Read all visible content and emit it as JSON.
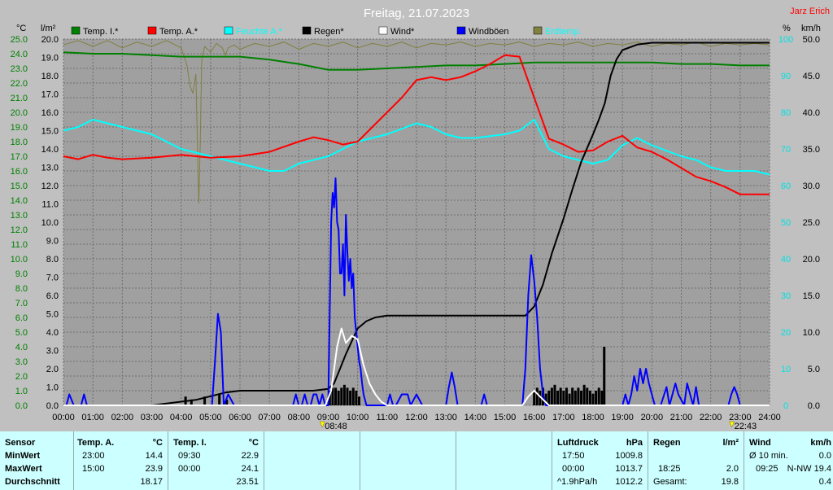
{
  "chart_data": {
    "type": "line",
    "title": "Freitag, 21.07.2023",
    "author": "Jarz Erich",
    "x_ticks": [
      "00:00",
      "01:00",
      "02:00",
      "03:00",
      "04:00",
      "05:00",
      "06:00",
      "07:00",
      "08:00",
      "09:00",
      "10:00",
      "11:00",
      "12:00",
      "13:00",
      "14:00",
      "15:00",
      "16:00",
      "17:00",
      "18:00",
      "19:00",
      "20:00",
      "21:00",
      "22:00",
      "23:00",
      "24:00"
    ],
    "y_temp": {
      "unit": "°C",
      "min": 0,
      "max": 25,
      "ticks": [
        "0.0",
        "1.0",
        "2.0",
        "3.0",
        "4.0",
        "5.0",
        "6.0",
        "7.0",
        "8.0",
        "9.0",
        "10.0",
        "11.0",
        "12.0",
        "13.0",
        "14.0",
        "15.0",
        "16.0",
        "17.0",
        "18.0",
        "19.0",
        "20.0",
        "21.0",
        "22.0",
        "23.0",
        "24.0",
        "25.0"
      ]
    },
    "y_rain": {
      "unit": "l/m²",
      "min": 0,
      "max": 20,
      "ticks": [
        "0.0",
        "1.0",
        "2.0",
        "3.0",
        "4.0",
        "5.0",
        "6.0",
        "7.0",
        "8.0",
        "9.0",
        "10.0",
        "11.0",
        "12.0",
        "13.0",
        "14.0",
        "15.0",
        "16.0",
        "17.0",
        "18.0",
        "19.0",
        "20.0"
      ]
    },
    "y_hum": {
      "unit": "%",
      "min": 0,
      "max": 100,
      "ticks": [
        "0",
        "10",
        "20",
        "30",
        "40",
        "50",
        "60",
        "70",
        "80",
        "90",
        "100"
      ]
    },
    "y_wind": {
      "unit": "km/h",
      "min": 0,
      "max": 50,
      "ticks": [
        "0.0",
        "5.0",
        "10.0",
        "15.0",
        "20.0",
        "25.0",
        "30.0",
        "35.0",
        "40.0",
        "45.0",
        "50.0"
      ]
    },
    "sun_markers": [
      {
        "hour": 8.8,
        "label": "08:48"
      },
      {
        "hour": 22.717,
        "label": "22:43"
      }
    ],
    "legend": [
      {
        "name": "Temp. I.*",
        "color": "#008000"
      },
      {
        "name": "Temp. A.*",
        "color": "#ff0000"
      },
      {
        "name": "Feuchte A.*",
        "color": "#00ffff"
      },
      {
        "name": "Regen*",
        "color": "#000000"
      },
      {
        "name": "Wind*",
        "color": "#ffffff"
      },
      {
        "name": "Windböen",
        "color": "#0000ff"
      },
      {
        "name": "Erdtemp.",
        "color": "#808040"
      }
    ],
    "series": [
      {
        "name": "Temp. I.*",
        "axis": "temp",
        "color": "#008000",
        "x": [
          0,
          1,
          2,
          3,
          4,
          5,
          6,
          7,
          8,
          9,
          10,
          11,
          12,
          13,
          14,
          15,
          16,
          17,
          18,
          19,
          20,
          21,
          22,
          23,
          24
        ],
        "y": [
          24.1,
          24.0,
          24.0,
          23.9,
          23.8,
          23.8,
          23.8,
          23.6,
          23.3,
          22.9,
          22.9,
          23.0,
          23.1,
          23.2,
          23.2,
          23.3,
          23.4,
          23.4,
          23.4,
          23.4,
          23.4,
          23.3,
          23.3,
          23.2,
          23.2
        ]
      },
      {
        "name": "Temp. A.*",
        "axis": "temp",
        "color": "#ff0000",
        "x": [
          0,
          0.5,
          1,
          1.5,
          2,
          3,
          4,
          5,
          6,
          7,
          8,
          8.5,
          9,
          9.5,
          10,
          10.5,
          11,
          11.5,
          12,
          12.5,
          13,
          13.5,
          14,
          14.5,
          15,
          15.5,
          16,
          16.5,
          17,
          17.5,
          18,
          18.5,
          19,
          19.5,
          20,
          20.5,
          21,
          21.5,
          22,
          22.5,
          23,
          23.5,
          24
        ],
        "y": [
          17.0,
          16.8,
          17.1,
          16.9,
          16.8,
          16.9,
          17.1,
          16.9,
          17.0,
          17.3,
          18.0,
          18.3,
          18.1,
          17.8,
          18.0,
          19.0,
          20.0,
          21.0,
          22.2,
          22.4,
          22.2,
          22.4,
          22.8,
          23.3,
          23.9,
          23.8,
          21.0,
          18.2,
          17.8,
          17.3,
          17.4,
          18.0,
          18.4,
          17.6,
          17.3,
          16.8,
          16.2,
          15.6,
          15.3,
          14.9,
          14.4,
          14.4,
          14.4
        ]
      },
      {
        "name": "Feuchte A.*",
        "axis": "hum",
        "color": "#00ffff",
        "x": [
          0,
          0.5,
          1,
          1.5,
          2,
          3,
          4,
          5,
          6,
          7,
          7.5,
          8,
          9,
          9.5,
          10,
          11,
          12,
          12.5,
          13,
          13.5,
          14,
          15,
          15.5,
          16,
          16.5,
          17,
          17.5,
          18,
          18.5,
          19,
          19.5,
          20,
          21,
          21.5,
          22,
          22.5,
          23,
          23.5,
          24
        ],
        "y": [
          75,
          76,
          78,
          77,
          76,
          74,
          70,
          68,
          66,
          64,
          64,
          66,
          68,
          70,
          72,
          74,
          77,
          76,
          74,
          73,
          73,
          74,
          75,
          78,
          70,
          68,
          67,
          66,
          67,
          71,
          73,
          71,
          68,
          67,
          65,
          64,
          64,
          64,
          63
        ]
      },
      {
        "name": "Regen*",
        "axis": "rain",
        "color": "#000000",
        "x": [
          0,
          3,
          3.5,
          4,
          4.5,
          5,
          5.5,
          6,
          7,
          8,
          8.5,
          9,
          9.2,
          9.4,
          9.6,
          9.8,
          10,
          10.3,
          10.6,
          11,
          12,
          13,
          14,
          15,
          15.7,
          16,
          16.3,
          16.6,
          17,
          17.3,
          17.6,
          18,
          18.2,
          18.4,
          18.6,
          18.8,
          19,
          19.5,
          20,
          21,
          22,
          23,
          24
        ],
        "y": [
          0,
          0,
          0.1,
          0.2,
          0.3,
          0.5,
          0.7,
          0.8,
          0.8,
          0.8,
          0.8,
          0.9,
          1.2,
          2.0,
          2.8,
          3.5,
          4.2,
          4.6,
          4.8,
          4.9,
          4.9,
          4.9,
          4.9,
          4.9,
          4.9,
          5.4,
          6.6,
          8.3,
          10.2,
          11.8,
          13.3,
          14.8,
          15.6,
          16.5,
          18.0,
          18.9,
          19.4,
          19.7,
          19.8,
          19.8,
          19.8,
          19.8,
          19.8
        ]
      },
      {
        "name": "Wind*",
        "axis": "wind",
        "color": "#ffffff",
        "x": [
          0,
          8.9,
          9.1,
          9.3,
          9.45,
          9.6,
          9.8,
          10,
          10.2,
          10.4,
          10.6,
          10.8,
          11,
          15.6,
          15.8,
          16,
          16.3,
          16.5,
          24
        ],
        "y": [
          0,
          0,
          2,
          8,
          10.5,
          8.5,
          9.5,
          9.0,
          5.5,
          3.0,
          1.5,
          0.5,
          0,
          0,
          1.2,
          2.0,
          0.8,
          0,
          0
        ]
      },
      {
        "name": "Windböen",
        "axis": "wind",
        "color": "#0000ff",
        "x": [
          0,
          0.1,
          0.2,
          0.35,
          0.6,
          0.7,
          0.8,
          1,
          5,
          5.05,
          5.15,
          5.25,
          5.35,
          5.45,
          5.6,
          5.8,
          7.8,
          7.9,
          8,
          8.1,
          8.2,
          8.3,
          8.4,
          8.5,
          8.6,
          8.7,
          8.8,
          8.9,
          9.0,
          9.1,
          9.15,
          9.2,
          9.25,
          9.3,
          9.35,
          9.4,
          9.45,
          9.5,
          9.55,
          9.6,
          9.65,
          9.7,
          9.75,
          9.8,
          9.85,
          9.9,
          9.95,
          10.0,
          10.05,
          10.1,
          10.15,
          10.2,
          10.3,
          11.0,
          11.1,
          11.2,
          11.3,
          11.5,
          11.6,
          11.7,
          11.8,
          12,
          12.2,
          12.3,
          13.0,
          13.1,
          13.2,
          13.3,
          13.4,
          14.2,
          14.3,
          14.4,
          15.6,
          15.7,
          15.8,
          15.9,
          16.0,
          16.1,
          16.2,
          16.3,
          16.4,
          16.5,
          18.0,
          19.0,
          19.1,
          19.2,
          19.3,
          19.4,
          19.5,
          19.6,
          19.7,
          19.8,
          19.9,
          20.0,
          20.1,
          20.2,
          20.3,
          20.5,
          20.6,
          20.8,
          20.9,
          21.1,
          21.2,
          21.4,
          21.5,
          21.6,
          22.6,
          22.7,
          22.8,
          22.9,
          23.0,
          24
        ],
        "y": [
          0,
          0,
          1.5,
          0,
          0,
          1.5,
          0,
          0,
          0,
          0,
          6,
          12.5,
          10,
          0,
          1.5,
          0,
          0,
          1.5,
          0,
          0,
          1.5,
          0,
          0,
          1.5,
          1.5,
          0,
          1.5,
          0,
          0,
          25,
          29,
          27,
          31,
          25,
          24,
          18,
          18,
          22,
          15,
          26,
          21,
          17,
          20,
          16,
          18,
          12,
          10,
          8,
          6,
          5,
          3,
          1.5,
          0,
          0,
          1.5,
          0,
          0,
          1.5,
          1.5,
          1.5,
          0,
          1.5,
          0,
          0,
          0,
          2.5,
          4.5,
          2.5,
          0,
          0,
          1.5,
          0,
          0,
          5,
          15,
          20.5,
          17,
          12,
          5,
          1.5,
          0,
          0,
          0,
          0,
          1.5,
          0,
          1.5,
          4,
          2,
          5,
          3,
          5,
          3,
          1.5,
          0,
          0,
          0,
          2.5,
          0,
          3,
          1.5,
          0,
          3,
          0,
          2.5,
          0,
          0,
          1.5,
          2.5,
          1.5,
          0,
          0
        ]
      },
      {
        "name": "Erdtemp.",
        "axis": "temp",
        "color": "#808040",
        "x": [
          0,
          0.5,
          1,
          1.5,
          2,
          2.5,
          3,
          3.5,
          4,
          4.2,
          4.3,
          4.4,
          4.5,
          4.55,
          4.6,
          4.65,
          4.7,
          4.8,
          5,
          5.2,
          5.4,
          5.5,
          5.6,
          5.8,
          6,
          6.5,
          7,
          7.5,
          8,
          8.5,
          9,
          9.5,
          10,
          10.5,
          11,
          11.5,
          12,
          12.5,
          13,
          13.5,
          14,
          14.5,
          15,
          15.5,
          16,
          16.5,
          17,
          17.5,
          18,
          18.5,
          19,
          19.5,
          20,
          20.5,
          21,
          21.5,
          22,
          22.5,
          23,
          23.5,
          24
        ],
        "y": [
          24.6,
          24.9,
          24.5,
          24.9,
          24.4,
          24.8,
          24.5,
          24.9,
          24.4,
          23.2,
          21.8,
          21.3,
          22.6,
          18.0,
          13.8,
          18.0,
          23.6,
          24.5,
          24.1,
          24.7,
          24.4,
          23.9,
          24.4,
          24.6,
          24.3,
          24.7,
          24.5,
          24.8,
          24.3,
          24.7,
          24.5,
          24.8,
          24.4,
          24.7,
          24.5,
          24.8,
          24.4,
          24.7,
          24.6,
          24.8,
          24.5,
          24.7,
          24.6,
          24.8,
          24.5,
          24.7,
          24.6,
          24.8,
          24.5,
          24.7,
          24.6,
          24.8,
          24.5,
          24.7,
          24.6,
          24.8,
          24.5,
          24.7,
          24.6,
          24.7,
          24.6
        ]
      }
    ],
    "rain_bars": {
      "x": [
        4.15,
        4.35,
        4.8,
        5.3,
        5.55,
        9.05,
        9.15,
        9.25,
        9.35,
        9.45,
        9.55,
        9.65,
        9.75,
        9.85,
        9.95,
        10.05,
        16.0,
        16.1,
        16.2,
        16.3,
        16.4,
        16.5,
        16.6,
        16.7,
        16.8,
        16.9,
        17.0,
        17.1,
        17.2,
        17.3,
        17.4,
        17.5,
        17.6,
        17.7,
        17.8,
        17.9,
        18.0,
        18.1,
        18.2,
        18.3,
        18.38
      ],
      "y": [
        0.3,
        0.2,
        0.3,
        0.4,
        0.2,
        0.5,
        0.6,
        0.6,
        0.5,
        0.6,
        0.7,
        0.6,
        0.5,
        0.6,
        0.5,
        0.3,
        0.5,
        0.6,
        0.5,
        0.6,
        0.4,
        0.5,
        0.6,
        0.7,
        0.5,
        0.6,
        0.5,
        0.6,
        0.4,
        0.6,
        0.5,
        0.6,
        0.5,
        0.7,
        0.6,
        0.5,
        0.4,
        0.5,
        0.6,
        0.5,
        2.0
      ]
    }
  },
  "footer": {
    "sensor": {
      "header": "Sensor",
      "rows": [
        "MinWert",
        "MaxWert",
        "Durchschnitt"
      ]
    },
    "temp_a": {
      "header": "Temp. A.",
      "unit": "°C",
      "rows": [
        [
          "23:00",
          "14.4"
        ],
        [
          "15:00",
          "23.9"
        ],
        [
          "",
          "18.17"
        ]
      ]
    },
    "temp_i": {
      "header": "Temp. I.",
      "unit": "°C",
      "rows": [
        [
          "09:30",
          "22.9"
        ],
        [
          "00:00",
          "24.1"
        ],
        [
          "",
          "23.51"
        ]
      ]
    },
    "luftdruck": {
      "header": "Luftdruck",
      "unit": "hPa",
      "rows": [
        [
          "17:50",
          "1009.8"
        ],
        [
          "00:00",
          "1013.7"
        ],
        [
          "^1.9hPa/h",
          "1012.2"
        ]
      ]
    },
    "regen": {
      "header": "Regen",
      "unit": "l/m²",
      "rows": [
        [
          "",
          ""
        ],
        [
          "18:25",
          "2.0"
        ],
        [
          "Gesamt:",
          "19.8"
        ]
      ]
    },
    "wind": {
      "header": "Wind",
      "unit": "km/h",
      "rows": [
        [
          "Ø 10 min.",
          "0.0"
        ],
        [
          "09:25",
          "N-NW 19.4"
        ],
        [
          "",
          "0.4"
        ]
      ]
    }
  }
}
